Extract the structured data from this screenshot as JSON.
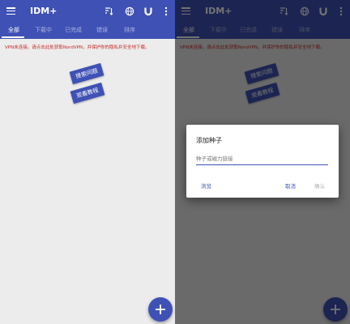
{
  "app": {
    "title": "IDM+"
  },
  "tabs": [
    "全部",
    "下载中",
    "已完成",
    "错误",
    "排序"
  ],
  "vpn_notice": "VPN未连接。请点击此处获取NordVPN，并保护你的隐私并安全地下载。",
  "buttons": {
    "search_problem": "搜索问题",
    "view_tutorial": "观看教程"
  },
  "dialog": {
    "title": "添加种子",
    "input_placeholder": "种子或磁力链接",
    "browse": "浏览",
    "cancel": "取消",
    "confirm": "确认"
  },
  "icons": [
    "menu-icon",
    "sort-icon",
    "globe-icon",
    "magnet-icon",
    "more-vert-icon",
    "add-icon"
  ],
  "colors": {
    "primary": "#3f51b5",
    "notice": "#c62828"
  }
}
